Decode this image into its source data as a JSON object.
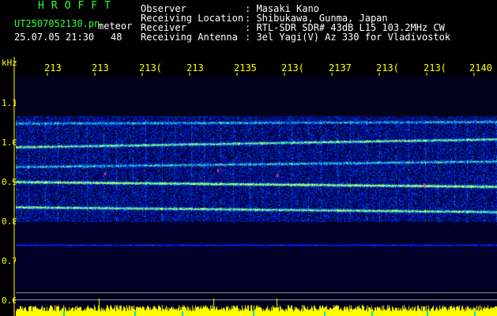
{
  "header": {
    "app_title": "HROFFT",
    "file_name": "UT2507052130.pn",
    "mode": "meteor",
    "datetime": "25.07.05 21:30",
    "count": "48"
  },
  "meta": [
    {
      "label": "Observer",
      "value": ": Masaki Kano"
    },
    {
      "label": "Receiving Location",
      "value": ": Shibukawa, Gunma, Japan"
    },
    {
      "label": "Receiver",
      "value": ": RTL-SDR SDR# 43dB L15 103.2MHz CW"
    },
    {
      "label": "Receiving Antenna",
      "value": ": 3el Yagi(V) Az 330 for Vladivostok"
    }
  ],
  "freq_axis": {
    "unit": "kHz",
    "ticks": [
      "1.1",
      "1.0",
      "0.9",
      "0.8",
      "0.7",
      "0.6"
    ]
  },
  "time_axis": {
    "ticks": [
      "213",
      "213",
      "213(",
      "213",
      "2135",
      "213(",
      "2137",
      "213(",
      "213(",
      "2140"
    ]
  },
  "colors": {
    "background": "#000000",
    "title_green": "#33ff33",
    "axis_yellow": "#ffff00",
    "meta_white": "#ffffff"
  }
}
